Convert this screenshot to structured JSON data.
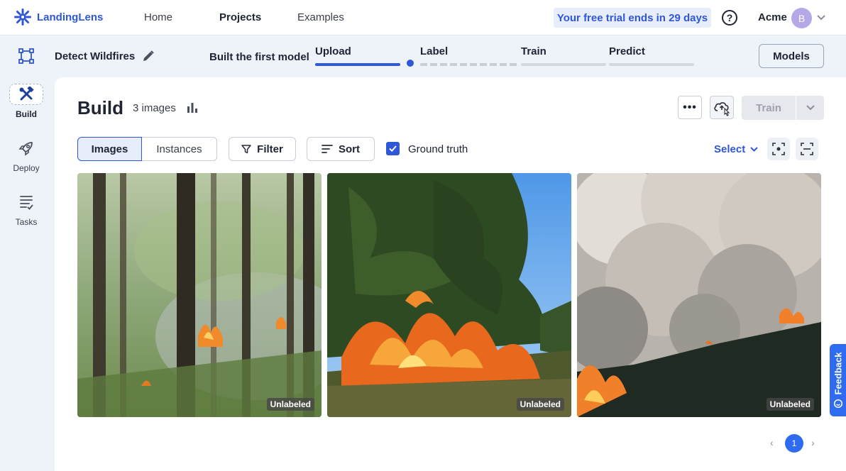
{
  "app": {
    "name": "LandingLens"
  },
  "topnav": {
    "links": [
      "Home",
      "Projects",
      "Examples"
    ],
    "trial_notice": "Your free trial ends in 29 days",
    "org_name": "Acme",
    "avatar_initial": "B"
  },
  "sidebar": {
    "items": [
      {
        "label": "Build"
      },
      {
        "label": "Deploy"
      },
      {
        "label": "Tasks"
      }
    ]
  },
  "project": {
    "name": "Detect Wildfires",
    "milestone": "Built the first model",
    "steps": [
      "Upload",
      "Label",
      "Train",
      "Predict"
    ],
    "models_button": "Models"
  },
  "build": {
    "title": "Build",
    "image_count": "3 images",
    "train_button": "Train",
    "tabs": [
      "Images",
      "Instances"
    ],
    "filter_label": "Filter",
    "sort_label": "Sort",
    "ground_truth_label": "Ground truth",
    "ground_truth_checked": true,
    "select_label": "Select"
  },
  "images": [
    {
      "status": "Unlabeled"
    },
    {
      "status": "Unlabeled"
    },
    {
      "status": "Unlabeled"
    }
  ],
  "pagination": {
    "current_page": "1"
  },
  "feedback": {
    "label": "Feedback"
  },
  "colors": {
    "accent": "#2e57d9",
    "page_badge": "#2e6bf0"
  }
}
